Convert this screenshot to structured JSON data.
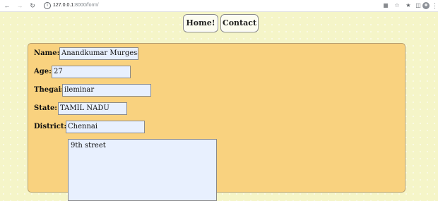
{
  "browser": {
    "url_host": "127.0.0.1",
    "url_path": ":8000/form/"
  },
  "nav": {
    "home_label": "Home!",
    "contact_label": "Contact"
  },
  "form": {
    "name": {
      "label": "Name:",
      "value": "Anandkumar Murgesan"
    },
    "age": {
      "label": "Age:",
      "value": "27"
    },
    "thegai": {
      "label": "Thegai:",
      "value": "ileminar"
    },
    "state": {
      "label": "State:",
      "value": "TAMIL NADU"
    },
    "district": {
      "label": "District:",
      "value": "Chennai"
    },
    "address": {
      "value": "9th street"
    }
  }
}
